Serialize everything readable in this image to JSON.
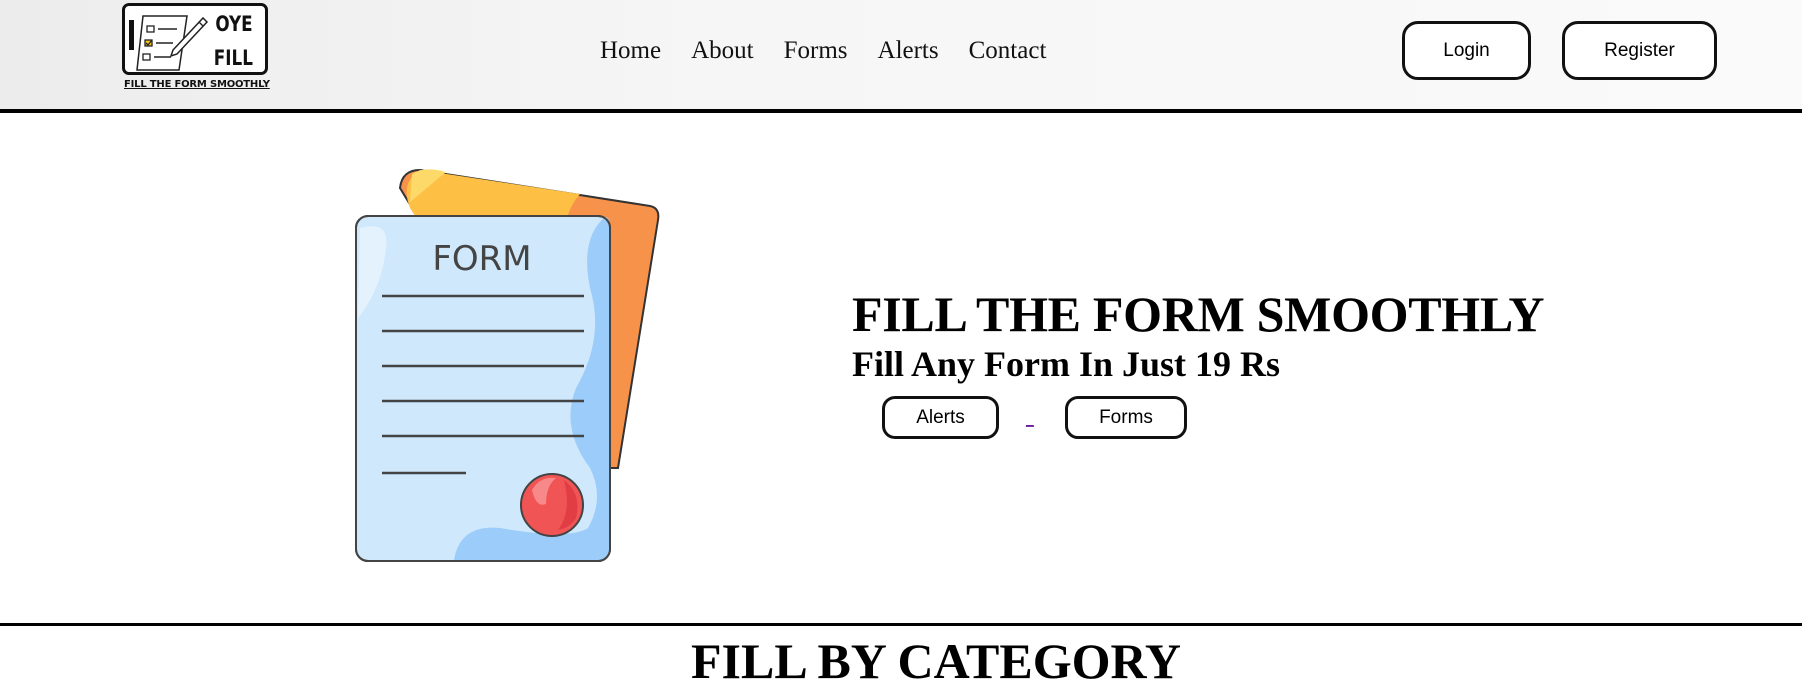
{
  "header": {
    "logo": {
      "word1": "OYE",
      "word2": "FILL",
      "tagline": "FILL THE FORM SMOOTHLY"
    },
    "nav": [
      {
        "label": "Home"
      },
      {
        "label": "About"
      },
      {
        "label": "Forms"
      },
      {
        "label": "Alerts"
      },
      {
        "label": "Contact"
      }
    ],
    "login_label": "Login",
    "register_label": "Register"
  },
  "hero": {
    "illustration_text": "FORM",
    "title": "FILL THE FORM SMOOTHLY",
    "subtitle": "Fill Any Form In Just 19 Rs",
    "alerts_button": "Alerts",
    "separator": "_",
    "forms_button": "Forms"
  },
  "section": {
    "title": "FILL BY CATEGORY"
  },
  "colors": {
    "border": "#111111",
    "form_paper": "#cfe8fc",
    "form_side": "#9ccdfa",
    "back_paper_orange": "#f7924a",
    "back_paper_yellow": "#fdc045",
    "seal_red": "#f05454"
  }
}
